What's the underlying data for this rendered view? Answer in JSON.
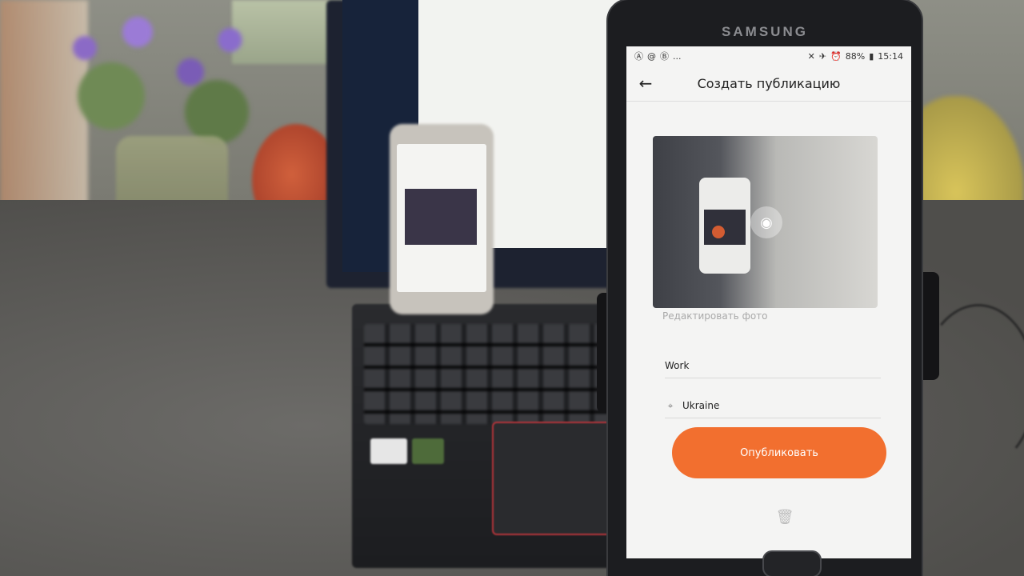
{
  "phone": {
    "brand": "SAMSUNG",
    "status": {
      "left_icons": [
        "a-icon",
        "at-icon",
        "b-icon"
      ],
      "dots": "...",
      "battery": "88%",
      "time": "15:14"
    },
    "header": {
      "title": "Создать публикацию"
    },
    "form": {
      "edit_photo_label": "Редактировать фото",
      "name_value": "Work",
      "location_value": "Ukraine",
      "publish_label": "Опубликовать"
    }
  },
  "colors": {
    "accent_orange": "#f26f2f"
  }
}
